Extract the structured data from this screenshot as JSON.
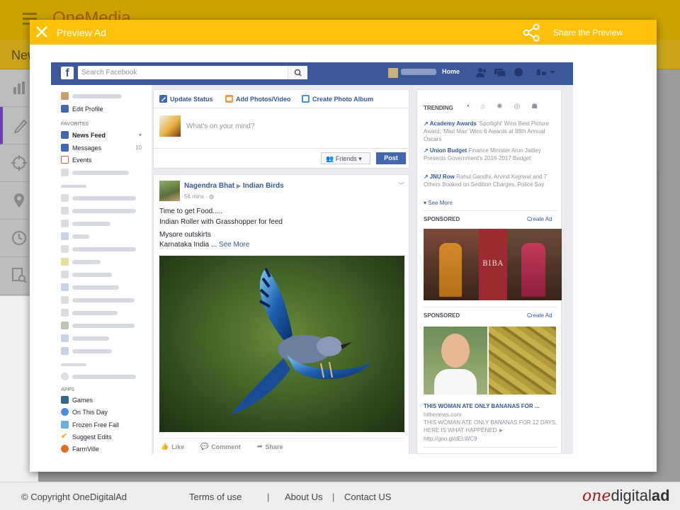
{
  "app": {
    "brand": "OneMedia",
    "subtitle": "New"
  },
  "modal": {
    "title": "Preview Ad",
    "share_label": "Share the Preview"
  },
  "fb": {
    "logo": "f",
    "search_placeholder": "Search Facebook",
    "home": "Home",
    "left": {
      "edit_profile": "Edit Profile",
      "favorites_header": "FAVORITES",
      "news_feed": "News Feed",
      "messages": "Messages",
      "messages_count": "10",
      "events": "Events",
      "apps_header": "APPS",
      "apps": [
        "Games",
        "On This Day",
        "Frozen Free Fall",
        "Suggest Edits",
        "FarmVille"
      ]
    },
    "composer": {
      "tabs": [
        "Update Status",
        "Add Photos/Video",
        "Create Photo Album"
      ],
      "placeholder": "What's on your mind?",
      "audience": "Friends",
      "post": "Post"
    },
    "post": {
      "author": "Nagendra Bhat",
      "target": "Indian Birds",
      "time": "56 mins",
      "lines": [
        "Time to get Food.....",
        "Indian Roller with Grasshopper for feed",
        "Mysore outskirts",
        "Karnataka India ..."
      ],
      "see_more": "See More",
      "actions": [
        "Like",
        "Comment",
        "Share"
      ]
    },
    "right": {
      "trending_header": "TRENDING",
      "trends": [
        {
          "topic": "Academy Awards",
          "text": "'Spotlight' Wins Best Picture Award; 'Mad Max' Wins 6 Awards at 88th Annual Oscars"
        },
        {
          "topic": "Union Budget",
          "text": "Finance Minister Arun Jaitley Presents Government's 2016-2017 Budget"
        },
        {
          "topic": "JNU Row",
          "text": "Rahul Gandhi, Arvind Kejriwal and 7 Others Booked on Sedition Charges, Police Say"
        }
      ],
      "see_more": "See More",
      "sponsored": "SPONSORED",
      "create_ad": "Create Ad",
      "ad1_brand": "BIBA",
      "ad2_title": "THIS WOMAN ATE ONLY BANANAS FOR ...",
      "ad2_domain": "hithenews.com",
      "ad2_text": "THIS WOMAN ATE ONLY BANANAS FOR 12 DAYS, HERE IS WHAT HAPPENED ►",
      "ad2_url": "http://goo.gl/dELWC9"
    }
  },
  "footer": {
    "copyright": "© Copyright  OneDigitalAd",
    "links": [
      "Terms of use",
      "About Us",
      "Contact US"
    ],
    "sep": "|",
    "logo_a": "one",
    "logo_b": "digital",
    "logo_c": "ad"
  },
  "colors": {
    "modal_header": "#ffc107",
    "fb_blue": "#3b5998",
    "link": "#365899"
  }
}
